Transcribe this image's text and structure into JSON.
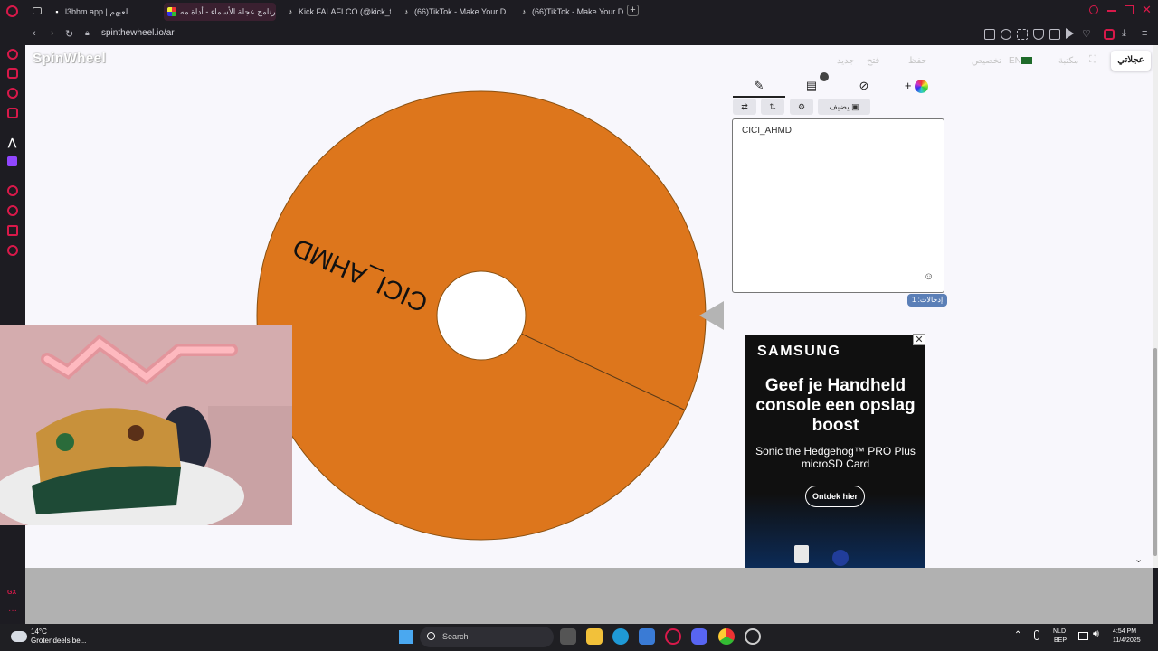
{
  "browser": {
    "tabs": [
      {
        "label": "l3bhm.app | لعبهم",
        "active": false
      },
      {
        "label": "برنامج عجلة الأسماء - أداة مه...",
        "active": true
      },
      {
        "label": "Kick FALAFLCO (@kick_fa...",
        "active": false
      },
      {
        "label": "(66)TikTok - Make Your D...",
        "active": false
      },
      {
        "label": "(66)TikTok - Make Your D...",
        "active": false
      }
    ],
    "url": "spinthewheel.io/ar"
  },
  "site": {
    "logo": "SpinWheel",
    "nav": [
      "جديد",
      "فتح",
      "حفظ",
      "مشاركة",
      "تخصيص",
      "EN",
      "مكتبة"
    ],
    "my_wheels": "عجلاتي"
  },
  "wheel": {
    "entries": [
      "CICI_AHMD"
    ],
    "color": "#dd761c"
  },
  "editor": {
    "tabs": [
      "✎",
      "📋",
      "👁",
      "+"
    ],
    "add_image_label": "يضيف",
    "entries_text": "CICI_AHMD",
    "entries_count_label": "إدخالات: 1"
  },
  "ad": {
    "brand": "SAMSUNG",
    "headline": "Geef je Handheld console een opslag boost",
    "sub": "Sonic the Hedgehog™ PRO Plus microSD Card",
    "cta": "Ontdek hier",
    "close": "✕"
  },
  "taskbar": {
    "weather_temp": "14°C",
    "weather_desc": "Grotendeels be...",
    "search": "Search",
    "lang1": "NLD",
    "lang2": "BEP",
    "time": "4:54 PM",
    "date": "11/4/2025"
  }
}
